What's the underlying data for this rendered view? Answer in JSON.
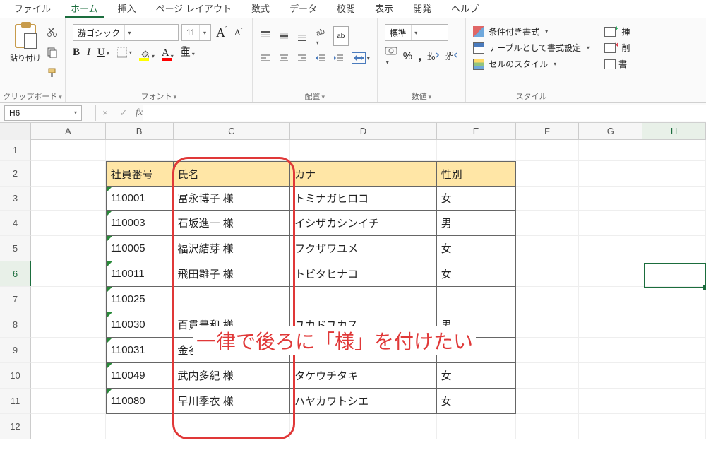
{
  "menu": {
    "items": [
      "ファイル",
      "ホーム",
      "挿入",
      "ページ レイアウト",
      "数式",
      "データ",
      "校閲",
      "表示",
      "開発",
      "ヘルプ"
    ],
    "active_index": 1
  },
  "ribbon": {
    "clipboard": {
      "paste_label": "貼り付け",
      "group": "クリップボード"
    },
    "font": {
      "name": "游ゴシック",
      "size": "11",
      "group": "フォント",
      "A_big": "A",
      "A_small": "A",
      "bold": "B",
      "italic": "I",
      "underline": "U",
      "fontcolor_letter": "A",
      "ruby": "亜",
      "ruby_rt": "ア"
    },
    "alignment": {
      "group": "配置"
    },
    "number": {
      "format": "標準",
      "group": "数値",
      "percent": "%",
      "comma": ","
    },
    "styles": {
      "cond_format": "条件付き書式",
      "format_table": "テーブルとして書式設定",
      "cell_styles": "セルのスタイル",
      "group": "スタイル"
    },
    "edge": {
      "insert": "挿",
      "delete": "削",
      "format": "書"
    }
  },
  "namebox": "H6",
  "columns": [
    "A",
    "B",
    "C",
    "D",
    "E",
    "F",
    "G",
    "H"
  ],
  "table": {
    "headers": {
      "b": "社員番号",
      "c": "氏名",
      "d": "カナ",
      "e": "性別"
    },
    "rows": [
      {
        "b": "110001",
        "c": "冨永博子 様",
        "d": "トミナガヒロコ",
        "e": "女"
      },
      {
        "b": "110003",
        "c": "石坂進一 様",
        "d": "イシザカシンイチ",
        "e": "男"
      },
      {
        "b": "110005",
        "c": "福沢結芽 様",
        "d": "フクザワユメ",
        "e": "女"
      },
      {
        "b": "110011",
        "c": "飛田雛子 様",
        "d": "トビタヒナコ",
        "e": "女"
      },
      {
        "b": "110025",
        "c": "",
        "d": "",
        "e": ""
      },
      {
        "b": "110030",
        "c": "百貫豊和 様",
        "d": "ユカドユカス",
        "e": "男"
      },
      {
        "b": "110031",
        "c": "金谷咲 様",
        "d": "カナヤサキ",
        "e": "女"
      },
      {
        "b": "110049",
        "c": "武内多紀 様",
        "d": "タケウチタキ",
        "e": "女"
      },
      {
        "b": "110080",
        "c": "早川季衣 様",
        "d": "ハヤカワトシエ",
        "e": "女"
      }
    ]
  },
  "annotation": "一律で後ろに「様」を付けたい"
}
